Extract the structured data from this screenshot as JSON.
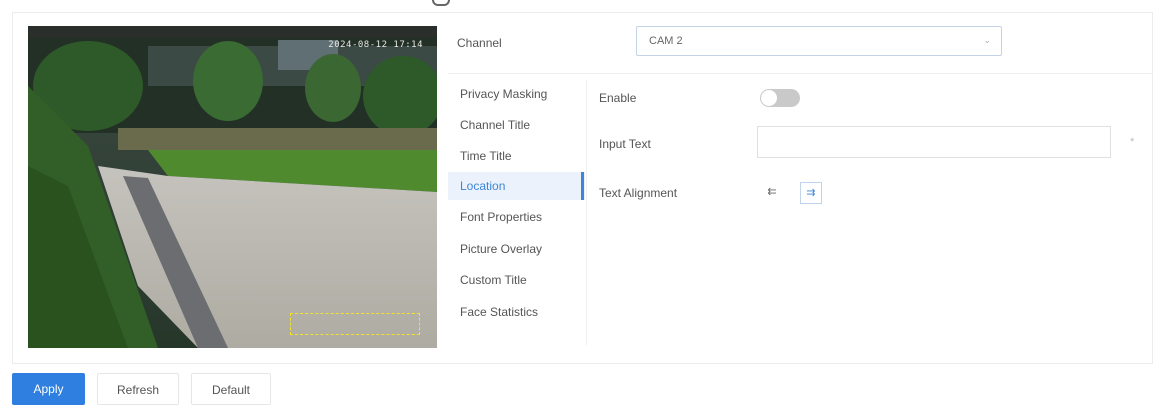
{
  "preview": {
    "osd_time": "2024-08-12 17:14",
    "osd_box_color": "#f3e229"
  },
  "channel": {
    "label": "Channel",
    "selected": "CAM 2"
  },
  "menu": {
    "items": [
      {
        "label": "Privacy Masking"
      },
      {
        "label": "Channel Title"
      },
      {
        "label": "Time Title"
      },
      {
        "label": "Location"
      },
      {
        "label": "Font Properties"
      },
      {
        "label": "Picture Overlay"
      },
      {
        "label": "Custom Title"
      },
      {
        "label": "Face Statistics"
      }
    ],
    "active_index": 3
  },
  "location": {
    "enable_label": "Enable",
    "enable_state": false,
    "input_label": "Input Text",
    "input_value": "",
    "asterisk": "*",
    "align_label": "Text Alignment",
    "align_options": [
      {
        "icon": "align-left-icon",
        "glyph": "⇇"
      },
      {
        "icon": "align-right-icon",
        "glyph": "⇉"
      }
    ],
    "align_selected": 1
  },
  "footer": {
    "apply_label": "Apply",
    "refresh_label": "Refresh",
    "default_label": "Default"
  },
  "colors": {
    "accent": "#2f7fe0",
    "active_menu_bg": "#ebf2fc"
  }
}
